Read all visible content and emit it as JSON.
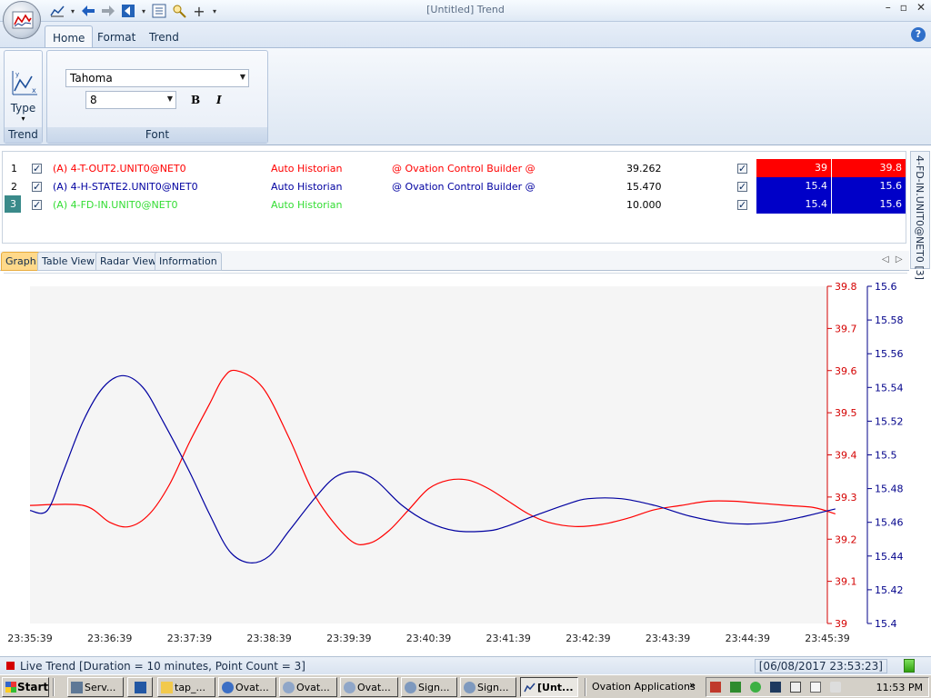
{
  "window": {
    "title": "[Untitled] Trend",
    "controls": [
      "minimize-icon",
      "restore-icon",
      "close-icon"
    ]
  },
  "quick_access": [
    "trend-icon",
    "back-arrow-icon",
    "forward-arrow-icon",
    "export-icon",
    "list-icon",
    "find-icon",
    "add-icon"
  ],
  "ribbon": {
    "tabs": [
      {
        "label": "Home",
        "active": true
      },
      {
        "label": "Format",
        "active": false
      },
      {
        "label": "Trend",
        "active": false
      }
    ],
    "trend_group": {
      "button_label": "Type",
      "group_label": "Trend"
    },
    "font_group": {
      "font_name": "Tahoma",
      "font_size": "8",
      "bold": "B",
      "italic": "I",
      "group_label": "Font"
    }
  },
  "pens": [
    {
      "index": "1",
      "checked": true,
      "name": "(A) 4-T-OUT2.UNIT0@NET0",
      "source": "Auto Historian",
      "builder": "@ Ovation Control Builder @",
      "value": "39.262",
      "scale_checked": true,
      "low": "39",
      "high": "39.8",
      "color": "#ff0000"
    },
    {
      "index": "2",
      "checked": true,
      "name": "(A) 4-H-STATE2.UNIT0@NET0",
      "source": "Auto Historian",
      "builder": "@ Ovation Control Builder @",
      "value": "15.470",
      "scale_checked": true,
      "low": "15.4",
      "high": "15.6",
      "color": "#0000a0"
    },
    {
      "index": "3",
      "checked": true,
      "name": "(A) 4-FD-IN.UNIT0@NET0",
      "source": "Auto Historian",
      "builder": "",
      "value": "10.000",
      "scale_checked": true,
      "low": "15.4",
      "high": "15.6",
      "color": "#33dd33"
    }
  ],
  "side_tab": {
    "label": "4-FD-IN.UNIT0@NET0 [3]"
  },
  "view_tabs": [
    {
      "label": "Graph",
      "active": true
    },
    {
      "label": "Table View",
      "active": false
    },
    {
      "label": "Radar View",
      "active": false
    },
    {
      "label": "Information",
      "active": false
    }
  ],
  "chart_data": {
    "type": "line",
    "grid": false,
    "x_ticks": [
      "23:35:39",
      "23:36:39",
      "23:37:39",
      "23:38:39",
      "23:39:39",
      "23:40:39",
      "23:41:39",
      "23:42:39",
      "23:43:39",
      "23:44:39",
      "23:45:39"
    ],
    "y_axes": [
      {
        "color": "#d40000",
        "ylim": [
          39,
          39.8
        ],
        "ticks": [
          "39.8",
          "39.7",
          "39.6",
          "39.5",
          "39.4",
          "39.3",
          "39.2",
          "39.1",
          "39"
        ]
      },
      {
        "color": "#00008a",
        "ylim": [
          15.4,
          15.6
        ],
        "ticks": [
          "15.6",
          "15.58",
          "15.56",
          "15.54",
          "15.52",
          "15.5",
          "15.48",
          "15.46",
          "15.44",
          "15.42",
          "15.4"
        ]
      }
    ],
    "series": [
      {
        "name": "(A) 4-T-OUT2.UNIT0@NET0",
        "axis": 0,
        "color": "#ff0000",
        "x": [
          "23:35:39",
          "23:36:19",
          "23:36:39",
          "23:36:54",
          "23:37:09",
          "23:37:24",
          "23:37:39",
          "23:37:54",
          "23:38:04",
          "23:38:14",
          "23:38:34",
          "23:38:54",
          "23:39:14",
          "23:39:39",
          "23:39:54",
          "23:40:09",
          "23:40:24",
          "23:40:39",
          "23:40:54",
          "23:41:09",
          "23:41:24",
          "23:41:39",
          "23:41:54",
          "23:42:09",
          "23:42:29",
          "23:42:49",
          "23:43:09",
          "23:43:29",
          "23:43:49",
          "23:44:09",
          "23:44:29",
          "23:44:49",
          "23:45:09",
          "23:45:29",
          "23:45:45"
        ],
        "y": [
          39.28,
          39.28,
          39.24,
          39.23,
          39.26,
          39.33,
          39.43,
          39.52,
          39.58,
          39.6,
          39.56,
          39.44,
          39.3,
          39.2,
          39.19,
          39.22,
          39.27,
          39.32,
          39.34,
          39.34,
          39.32,
          39.29,
          39.26,
          39.24,
          39.23,
          39.235,
          39.25,
          39.27,
          39.28,
          39.29,
          39.29,
          39.285,
          39.28,
          39.275,
          39.26
        ]
      },
      {
        "name": "(A) 4-H-STATE2.UNIT0@NET0",
        "axis": 1,
        "color": "#0000a0",
        "x": [
          "23:35:39",
          "23:35:52",
          "23:36:04",
          "23:36:19",
          "23:36:34",
          "23:36:49",
          "23:37:04",
          "23:37:19",
          "23:37:39",
          "23:37:54",
          "23:38:09",
          "23:38:24",
          "23:38:39",
          "23:38:54",
          "23:39:14",
          "23:39:29",
          "23:39:44",
          "23:39:59",
          "23:40:19",
          "23:40:39",
          "23:40:59",
          "23:41:24",
          "23:41:39",
          "23:41:59",
          "23:42:24",
          "23:42:39",
          "23:43:04",
          "23:43:29",
          "23:43:54",
          "23:44:19",
          "23:44:39",
          "23:44:59",
          "23:45:19",
          "23:45:45"
        ],
        "y": [
          15.467,
          15.467,
          15.49,
          15.52,
          15.54,
          15.547,
          15.54,
          15.52,
          15.49,
          15.465,
          15.443,
          15.436,
          15.44,
          15.455,
          15.475,
          15.487,
          15.49,
          15.485,
          15.47,
          15.46,
          15.455,
          15.455,
          15.458,
          15.464,
          15.471,
          15.474,
          15.474,
          15.47,
          15.464,
          15.46,
          15.459,
          15.46,
          15.463,
          15.468
        ]
      }
    ]
  },
  "status": {
    "text": "Live Trend [Duration = 10 minutes, Point Count = 3]",
    "date": "[06/08/2017 23:53:23]"
  },
  "taskbar": {
    "start": "Start",
    "buttons": [
      {
        "label": "Serv...",
        "icon": "server-icon",
        "active": false
      },
      {
        "label": "",
        "icon": "powershell-icon",
        "active": false
      },
      {
        "label": "tap_...",
        "icon": "folder-icon",
        "active": false
      },
      {
        "label": "Ovat...",
        "icon": "ovation-icon",
        "active": false
      },
      {
        "label": "Ovat...",
        "icon": "ovation-icon",
        "active": false
      },
      {
        "label": "Ovat...",
        "icon": "ovation-icon",
        "active": false
      },
      {
        "label": "Sign...",
        "icon": "signal-icon",
        "active": false
      },
      {
        "label": "Sign...",
        "icon": "signal-icon",
        "active": false
      },
      {
        "label": "[Unt...",
        "icon": "trend-icon",
        "active": true
      }
    ],
    "tray_label": "Ovation Applications",
    "clock": "11:53 PM"
  }
}
